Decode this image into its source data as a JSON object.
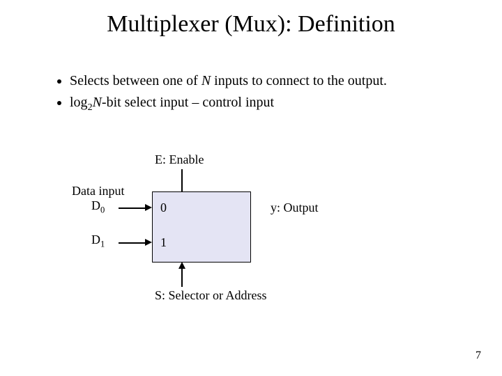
{
  "title": "Multiplexer (Mux): Definition",
  "bullets": {
    "b1_pre": "Selects between one of ",
    "b1_N": "N",
    "b1_post": " inputs to connect to the output.",
    "b2_pre": "log",
    "b2_sub": "2",
    "b2_N": "N",
    "b2_post": "-bit select input – control input"
  },
  "labels": {
    "enable": "E: Enable",
    "data_input": "Data input",
    "d0": "D",
    "d0_sub": "0",
    "d1": "D",
    "d1_sub": "1",
    "in0": "0",
    "in1": "1",
    "output": "y: Output",
    "selector": "S: Selector or Address"
  },
  "page_number": "7"
}
